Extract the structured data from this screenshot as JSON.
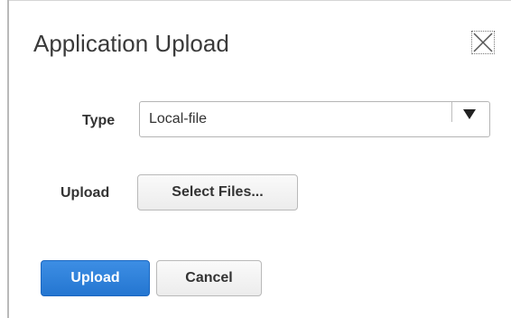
{
  "dialog": {
    "title": "Application Upload",
    "close_icon": "close-x-icon"
  },
  "form": {
    "type_label": "Type",
    "type_value": "Local-file",
    "dropdown_icon": "triangle-down-icon",
    "upload_label": "Upload",
    "select_files_label": "Select Files..."
  },
  "actions": {
    "upload_label": "Upload",
    "cancel_label": "Cancel"
  },
  "colors": {
    "primary": "#2a7ad6",
    "text": "#333333"
  }
}
